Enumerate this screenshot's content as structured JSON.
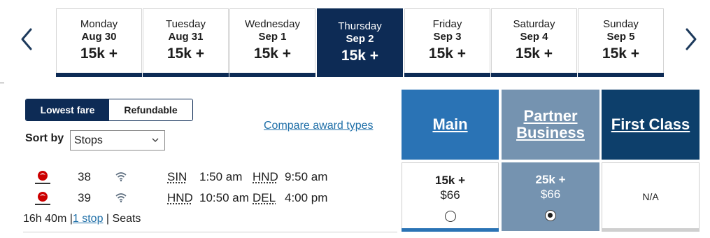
{
  "date_strip": {
    "days": [
      {
        "day": "Monday",
        "date": "Aug 30",
        "price": "15k +",
        "selected": false
      },
      {
        "day": "Tuesday",
        "date": "Aug 31",
        "price": "15k +",
        "selected": false
      },
      {
        "day": "Wednesday",
        "date": "Sep 1",
        "price": "15k +",
        "selected": false
      },
      {
        "day": "Thursday",
        "date": "Sep 2",
        "price": "15k +",
        "selected": true
      },
      {
        "day": "Friday",
        "date": "Sep 3",
        "price": "15k +",
        "selected": false
      },
      {
        "day": "Saturday",
        "date": "Sep 4",
        "price": "15k +",
        "selected": false
      },
      {
        "day": "Sunday",
        "date": "Sep 5",
        "price": "15k +",
        "selected": false
      }
    ],
    "prev_icon": "chevron-left-icon",
    "next_icon": "chevron-right-icon"
  },
  "filters": {
    "fare_toggle": {
      "lowest": "Lowest fare",
      "refundable": "Refundable",
      "active": "lowest"
    },
    "sort_label": "Sort by",
    "sort_value": "Stops",
    "compare_link": "Compare award types"
  },
  "cabins": {
    "main": {
      "label": "Main"
    },
    "partner": {
      "label_line1": "Partner",
      "label_line2": "Business"
    },
    "first": {
      "label": "First Class"
    }
  },
  "fares": {
    "main": {
      "points": "15k +",
      "cash": "$66",
      "selected": false
    },
    "partner": {
      "points": "25k +",
      "cash": "$66",
      "selected": true
    },
    "first": {
      "text": "N/A"
    }
  },
  "flight": {
    "segments": [
      {
        "airline_icon": "japan-airlines-logo-icon",
        "number": "38",
        "wifi_icon": "wifi-icon",
        "from": "SIN",
        "depart": "1:50 am",
        "to": "HND",
        "arrive": "9:50 am"
      },
      {
        "airline_icon": "japan-airlines-logo-icon",
        "number": "39",
        "wifi_icon": "wifi-icon",
        "from": "HND",
        "depart": "10:50 am",
        "to": "DEL",
        "arrive": "4:00 pm"
      }
    ],
    "duration": "16h 40m",
    "stops": "1 stop",
    "seats": "Seats"
  },
  "colors": {
    "navy": "#0d2b55",
    "main_blue": "#2a73b5",
    "partner_slate": "#7593b0",
    "first_navy": "#0d3f6b",
    "link_blue": "#1f6fa8"
  }
}
